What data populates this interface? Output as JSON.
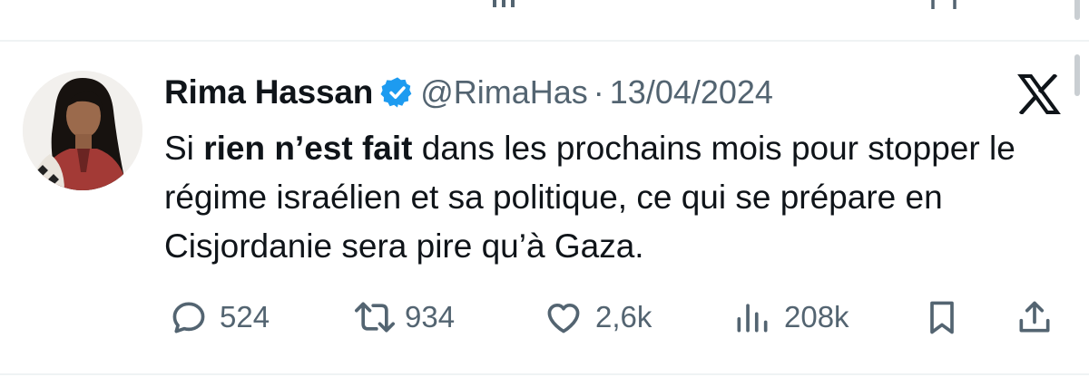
{
  "tweet": {
    "author_name": "Rima Hassan",
    "handle": "@RimaHas",
    "separator": "·",
    "date": "13/04/2024",
    "text_before": "Si ",
    "text_bold": "rien n’est fait",
    "text_after": " dans les prochains mois pour stopper le régime israélien et sa politique, ce qui se prépare en Cisjordanie sera pire qu’à Gaza.",
    "verified": true
  },
  "actions": {
    "replies": "524",
    "reposts": "934",
    "likes": "2,6k",
    "views": "208k"
  },
  "icons": {
    "verified": "verified-badge-icon",
    "platform_logo": "x-logo-icon",
    "reply": "reply-icon",
    "repost": "repost-icon",
    "like": "heart-icon",
    "views": "views-icon",
    "bookmark": "bookmark-icon",
    "share": "share-icon"
  },
  "colors": {
    "text": "#0f1419",
    "muted": "#536471",
    "verified_blue": "#1d9bf0",
    "divider": "#eff3f4"
  }
}
